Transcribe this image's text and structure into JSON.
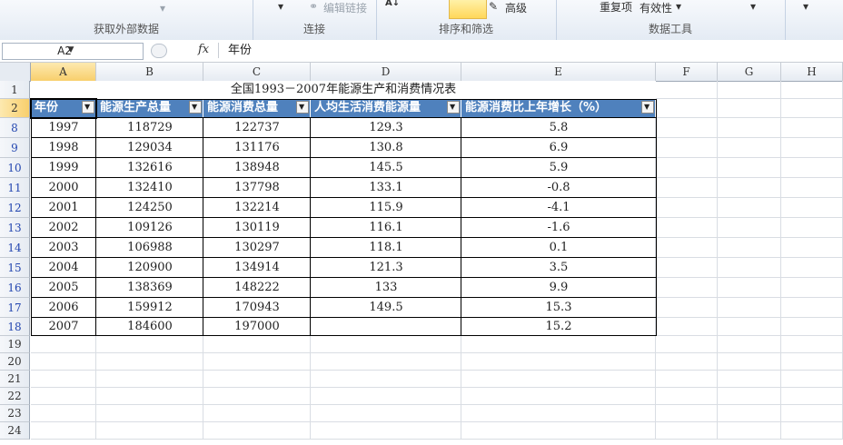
{
  "ribbon": {
    "groups": [
      {
        "label": "获取外部数据"
      },
      {
        "label": "连接"
      },
      {
        "label": "排序和筛选"
      },
      {
        "label": "数据工具"
      }
    ],
    "edit_links": "编辑链接",
    "advanced": "高级",
    "remove_dup": "重复项",
    "validation": "有效性"
  },
  "formula_bar": {
    "name_box": "A2",
    "fx": "fx",
    "content": "年份"
  },
  "columns": [
    "A",
    "B",
    "C",
    "D",
    "E",
    "F",
    "G",
    "H"
  ],
  "rows": [
    "1",
    "2",
    "8",
    "9",
    "10",
    "11",
    "12",
    "13",
    "14",
    "15",
    "16",
    "17",
    "18",
    "19",
    "20",
    "21",
    "22",
    "23",
    "24"
  ],
  "sheet": {
    "title": "全国1993－2007年能源生产和消费情况表",
    "headers": [
      "年份",
      "能源生产总量",
      "能源消费总量",
      "人均生活消费能源量",
      "能源消费比上年增长（%）"
    ],
    "data": [
      [
        "1997",
        "118729",
        "122737",
        "129.3",
        "5.8"
      ],
      [
        "1998",
        "129034",
        "131176",
        "130.8",
        "6.9"
      ],
      [
        "1999",
        "132616",
        "138948",
        "145.5",
        "5.9"
      ],
      [
        "2000",
        "132410",
        "137798",
        "133.1",
        "-0.8"
      ],
      [
        "2001",
        "124250",
        "132214",
        "115.9",
        "-4.1"
      ],
      [
        "2002",
        "109126",
        "130119",
        "116.1",
        "-1.6"
      ],
      [
        "2003",
        "106988",
        "130297",
        "118.1",
        "0.1"
      ],
      [
        "2004",
        "120900",
        "134914",
        "121.3",
        "3.5"
      ],
      [
        "2005",
        "138369",
        "148222",
        "133",
        "9.9"
      ],
      [
        "2006",
        "159912",
        "170943",
        "149.5",
        "15.3"
      ],
      [
        "2007",
        "184600",
        "197000",
        "",
        "15.2"
      ]
    ]
  },
  "colors": {
    "header_bg": "#4f81bd",
    "filtered_row_num": "#2346b0"
  }
}
